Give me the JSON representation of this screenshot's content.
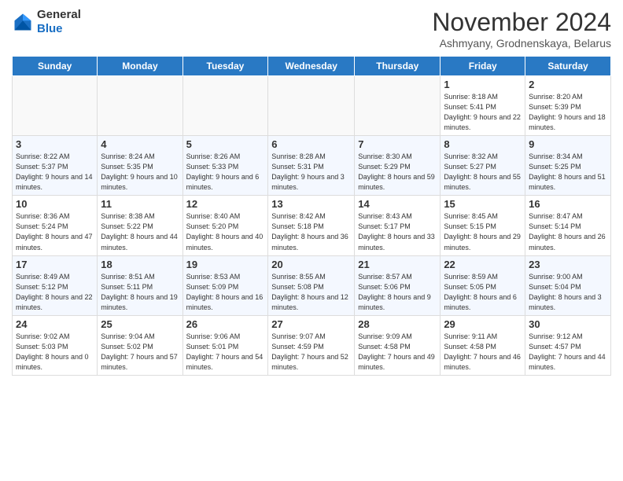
{
  "header": {
    "logo_general": "General",
    "logo_blue": "Blue",
    "month_title": "November 2024",
    "location": "Ashmyany, Grodnenskaya, Belarus"
  },
  "weekdays": [
    "Sunday",
    "Monday",
    "Tuesday",
    "Wednesday",
    "Thursday",
    "Friday",
    "Saturday"
  ],
  "weeks": [
    [
      {
        "day": "",
        "info": ""
      },
      {
        "day": "",
        "info": ""
      },
      {
        "day": "",
        "info": ""
      },
      {
        "day": "",
        "info": ""
      },
      {
        "day": "",
        "info": ""
      },
      {
        "day": "1",
        "info": "Sunrise: 8:18 AM\nSunset: 5:41 PM\nDaylight: 9 hours and 22 minutes."
      },
      {
        "day": "2",
        "info": "Sunrise: 8:20 AM\nSunset: 5:39 PM\nDaylight: 9 hours and 18 minutes."
      }
    ],
    [
      {
        "day": "3",
        "info": "Sunrise: 8:22 AM\nSunset: 5:37 PM\nDaylight: 9 hours and 14 minutes."
      },
      {
        "day": "4",
        "info": "Sunrise: 8:24 AM\nSunset: 5:35 PM\nDaylight: 9 hours and 10 minutes."
      },
      {
        "day": "5",
        "info": "Sunrise: 8:26 AM\nSunset: 5:33 PM\nDaylight: 9 hours and 6 minutes."
      },
      {
        "day": "6",
        "info": "Sunrise: 8:28 AM\nSunset: 5:31 PM\nDaylight: 9 hours and 3 minutes."
      },
      {
        "day": "7",
        "info": "Sunrise: 8:30 AM\nSunset: 5:29 PM\nDaylight: 8 hours and 59 minutes."
      },
      {
        "day": "8",
        "info": "Sunrise: 8:32 AM\nSunset: 5:27 PM\nDaylight: 8 hours and 55 minutes."
      },
      {
        "day": "9",
        "info": "Sunrise: 8:34 AM\nSunset: 5:25 PM\nDaylight: 8 hours and 51 minutes."
      }
    ],
    [
      {
        "day": "10",
        "info": "Sunrise: 8:36 AM\nSunset: 5:24 PM\nDaylight: 8 hours and 47 minutes."
      },
      {
        "day": "11",
        "info": "Sunrise: 8:38 AM\nSunset: 5:22 PM\nDaylight: 8 hours and 44 minutes."
      },
      {
        "day": "12",
        "info": "Sunrise: 8:40 AM\nSunset: 5:20 PM\nDaylight: 8 hours and 40 minutes."
      },
      {
        "day": "13",
        "info": "Sunrise: 8:42 AM\nSunset: 5:18 PM\nDaylight: 8 hours and 36 minutes."
      },
      {
        "day": "14",
        "info": "Sunrise: 8:43 AM\nSunset: 5:17 PM\nDaylight: 8 hours and 33 minutes."
      },
      {
        "day": "15",
        "info": "Sunrise: 8:45 AM\nSunset: 5:15 PM\nDaylight: 8 hours and 29 minutes."
      },
      {
        "day": "16",
        "info": "Sunrise: 8:47 AM\nSunset: 5:14 PM\nDaylight: 8 hours and 26 minutes."
      }
    ],
    [
      {
        "day": "17",
        "info": "Sunrise: 8:49 AM\nSunset: 5:12 PM\nDaylight: 8 hours and 22 minutes."
      },
      {
        "day": "18",
        "info": "Sunrise: 8:51 AM\nSunset: 5:11 PM\nDaylight: 8 hours and 19 minutes."
      },
      {
        "day": "19",
        "info": "Sunrise: 8:53 AM\nSunset: 5:09 PM\nDaylight: 8 hours and 16 minutes."
      },
      {
        "day": "20",
        "info": "Sunrise: 8:55 AM\nSunset: 5:08 PM\nDaylight: 8 hours and 12 minutes."
      },
      {
        "day": "21",
        "info": "Sunrise: 8:57 AM\nSunset: 5:06 PM\nDaylight: 8 hours and 9 minutes."
      },
      {
        "day": "22",
        "info": "Sunrise: 8:59 AM\nSunset: 5:05 PM\nDaylight: 8 hours and 6 minutes."
      },
      {
        "day": "23",
        "info": "Sunrise: 9:00 AM\nSunset: 5:04 PM\nDaylight: 8 hours and 3 minutes."
      }
    ],
    [
      {
        "day": "24",
        "info": "Sunrise: 9:02 AM\nSunset: 5:03 PM\nDaylight: 8 hours and 0 minutes."
      },
      {
        "day": "25",
        "info": "Sunrise: 9:04 AM\nSunset: 5:02 PM\nDaylight: 7 hours and 57 minutes."
      },
      {
        "day": "26",
        "info": "Sunrise: 9:06 AM\nSunset: 5:01 PM\nDaylight: 7 hours and 54 minutes."
      },
      {
        "day": "27",
        "info": "Sunrise: 9:07 AM\nSunset: 4:59 PM\nDaylight: 7 hours and 52 minutes."
      },
      {
        "day": "28",
        "info": "Sunrise: 9:09 AM\nSunset: 4:58 PM\nDaylight: 7 hours and 49 minutes."
      },
      {
        "day": "29",
        "info": "Sunrise: 9:11 AM\nSunset: 4:58 PM\nDaylight: 7 hours and 46 minutes."
      },
      {
        "day": "30",
        "info": "Sunrise: 9:12 AM\nSunset: 4:57 PM\nDaylight: 7 hours and 44 minutes."
      }
    ]
  ]
}
